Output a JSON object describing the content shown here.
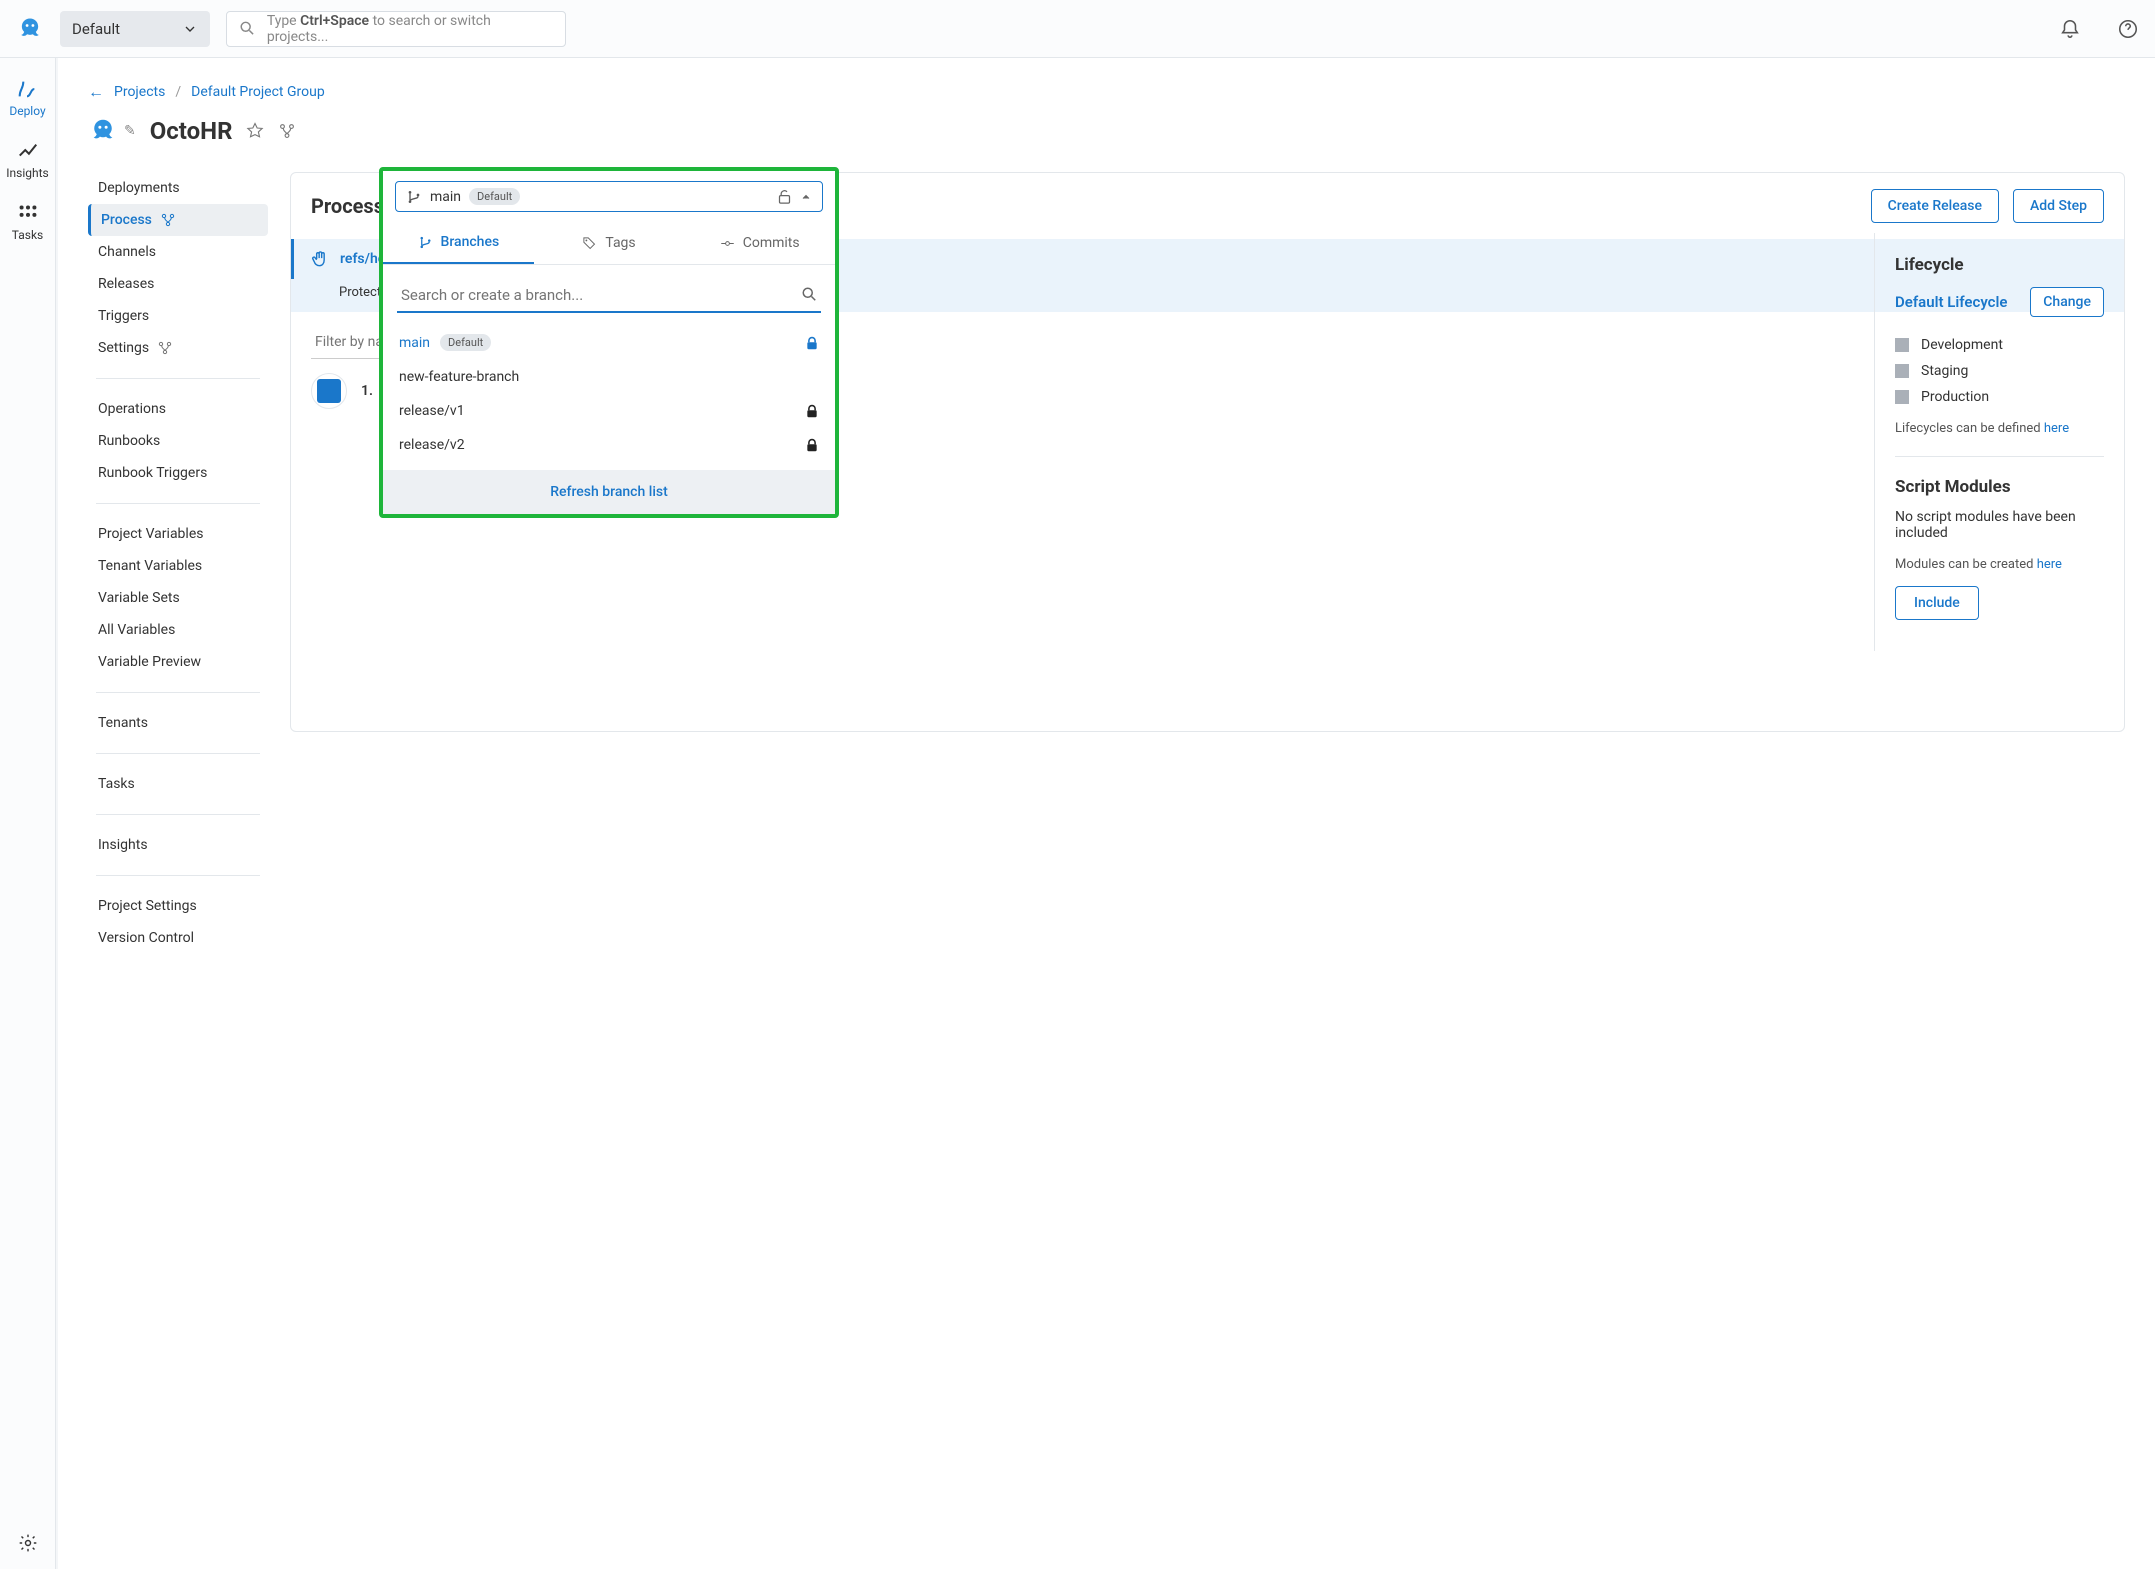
{
  "top": {
    "space": "Default",
    "search_prefix": "Type ",
    "search_kbd": "Ctrl+Space",
    "search_suffix": " to search or switch projects..."
  },
  "rail": {
    "deploy": "Deploy",
    "insights": "Insights",
    "tasks": "Tasks"
  },
  "breadcrumbs": {
    "projects": "Projects",
    "group": "Default Project Group"
  },
  "project": {
    "name": "OctoHR"
  },
  "sidebar": {
    "items": [
      "Deployments",
      "Process",
      "Channels",
      "Releases",
      "Triggers",
      "Settings"
    ],
    "group2": [
      "Operations",
      "Runbooks",
      "Runbook Triggers"
    ],
    "group3": [
      "Project Variables",
      "Tenant Variables",
      "Variable Sets",
      "All Variables",
      "Variable Preview"
    ],
    "group4": [
      "Tenants"
    ],
    "group5": [
      "Tasks"
    ],
    "group6": [
      "Insights"
    ],
    "group7": [
      "Project Settings",
      "Version Control"
    ]
  },
  "panel": {
    "title": "Process",
    "create_release": "Create Release",
    "add_step": "Add Step",
    "ref": "refs/hea",
    "protected": "Protecte",
    "filter_placeholder": "Filter by na",
    "step_num": "1."
  },
  "branch_chip": {
    "name": "main",
    "default_badge": "Default"
  },
  "popover": {
    "tabs": {
      "branches": "Branches",
      "tags": "Tags",
      "commits": "Commits"
    },
    "search_placeholder": "Search or create a branch...",
    "items": [
      {
        "name": "main",
        "default": true,
        "locked": true,
        "selected": true
      },
      {
        "name": "new-feature-branch",
        "default": false,
        "locked": false,
        "selected": false
      },
      {
        "name": "release/v1",
        "default": false,
        "locked": true,
        "selected": false
      },
      {
        "name": "release/v2",
        "default": false,
        "locked": true,
        "selected": false
      }
    ],
    "refresh": "Refresh branch list"
  },
  "right": {
    "lifecycle_title": "Lifecycle",
    "lifecycle_name": "Default Lifecycle",
    "change": "Change",
    "stages": [
      "Development",
      "Staging",
      "Production"
    ],
    "lifecycle_hint": "Lifecycles can be defined ",
    "here": "here",
    "modules_title": "Script Modules",
    "modules_empty": "No script modules have been included",
    "modules_hint": "Modules can be created ",
    "include": "Include"
  }
}
